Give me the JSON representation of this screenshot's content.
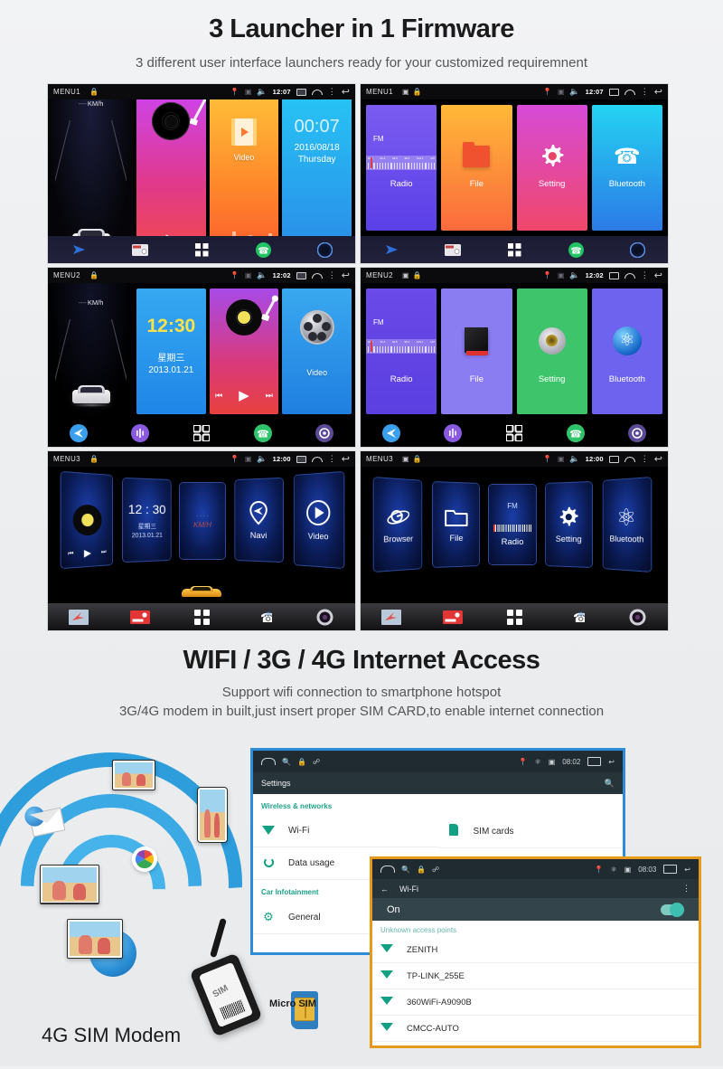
{
  "section1": {
    "title": "3 Launcher in 1 Firmware",
    "subtitle": "3 different user interface launchers ready for your customized requiremnent"
  },
  "section2": {
    "title": "WIFI / 3G / 4G Internet Access",
    "subtitle1": "Support wifi connection to smartphone hotspot",
    "subtitle2": "3G/4G modem in built,just insert proper SIM CARD,to enable internet connection"
  },
  "launchers": [
    {
      "menu_label": "MENU1",
      "time": "12:07",
      "home_tiles": [
        {
          "label": "",
          "type": "music"
        },
        {
          "label": "Video",
          "type": "video"
        },
        {
          "clock": "00:07",
          "date": "2016/08/18",
          "day": "Thursday",
          "type": "clock"
        }
      ],
      "speed_unit": "KM/h",
      "speed_value": "- - - -",
      "app_tiles": [
        {
          "label": "Radio",
          "badge": "FM"
        },
        {
          "label": "File"
        },
        {
          "label": "Setting"
        },
        {
          "label": "Bluetooth"
        }
      ]
    },
    {
      "menu_label": "MENU2",
      "time": "12:02",
      "home_tiles": [
        {
          "clock": "12:30",
          "day": "星期三",
          "date": "2013.01.21",
          "type": "clock"
        },
        {
          "label": "",
          "type": "music"
        },
        {
          "label": "Video",
          "type": "video"
        }
      ],
      "speed_unit": "KM/h",
      "speed_value": "- - - -",
      "app_tiles": [
        {
          "label": "Radio",
          "badge": "FM"
        },
        {
          "label": "File"
        },
        {
          "label": "Setting"
        },
        {
          "label": "Bluetooth"
        }
      ]
    },
    {
      "menu_label": "MENU3",
      "time": "12:00",
      "home_cards": [
        {
          "label": "",
          "type": "music"
        },
        {
          "clock": "12 : 30",
          "day": "星期三",
          "date": "2013.01.21",
          "type": "clock"
        },
        {
          "label": "KM/H",
          "type": "speed"
        },
        {
          "label": "Navi",
          "type": "navi"
        },
        {
          "label": "Video",
          "type": "video"
        }
      ],
      "app_cards": [
        {
          "label": "Browser"
        },
        {
          "label": "File"
        },
        {
          "label": "Radio",
          "badge": "FM"
        },
        {
          "label": "Setting"
        },
        {
          "label": "Bluetooth"
        }
      ]
    }
  ],
  "fm_scale_numbers": [
    "87.5",
    "91.4",
    "94.5",
    "98.2",
    "103.1",
    "107"
  ],
  "settings_panel": {
    "status_time": "08:02",
    "title": "Settings",
    "categories": [
      {
        "name": "Wireless & networks",
        "rows_left": [
          "Wi-Fi",
          "Data usage"
        ],
        "rows_right": [
          "SIM cards"
        ]
      },
      {
        "name": "Car Infotainment",
        "rows_left": [
          "General"
        ],
        "rows_right": []
      }
    ],
    "icons": [
      "search-icon",
      "home-icon",
      "lock-icon",
      "usb-icon",
      "location-icon",
      "bluetooth-icon",
      "sim-icon",
      "recents-icon",
      "back-icon"
    ]
  },
  "wifi_panel": {
    "status_time": "08:03",
    "title": "Wi-Fi",
    "toggle_label": "On",
    "toggle_state": "on",
    "section_label": "Unknown access points",
    "access_points": [
      "ZENITH",
      "TP-LINK_255E",
      "360WiFi-A9090B",
      "CMCC-AUTO"
    ]
  },
  "artwork": {
    "modem_label": "4G SIM Modem",
    "micro_sim_label": "Micro SIM",
    "modem_body_text": "SIM"
  }
}
